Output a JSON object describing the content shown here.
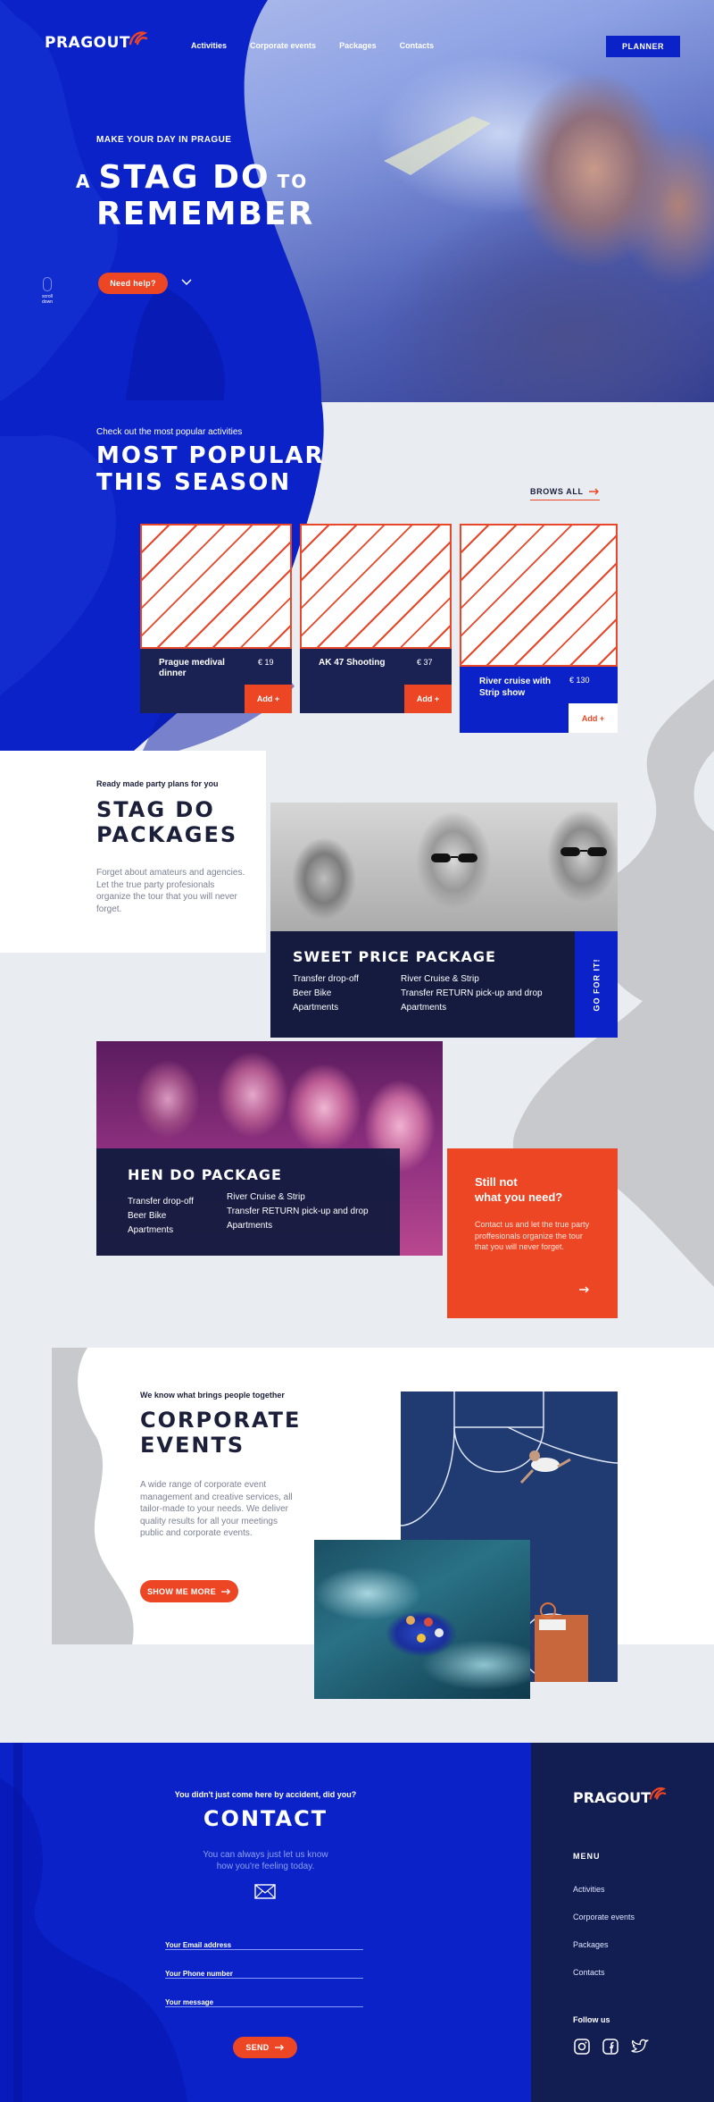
{
  "brand": {
    "logo": "PRAGOUT",
    "colors": {
      "primary_blue": "#0a22c8",
      "accent_red": "#ec4624",
      "navy": "#121d52",
      "bg": "#e9ecf1"
    }
  },
  "nav": {
    "items": [
      "Activities",
      "Corporate events",
      "Packages",
      "Contacts"
    ],
    "cta": "PLANNER"
  },
  "hero": {
    "eyebrow": "MAKE YOUR DAY IN PRAGUE",
    "title_a": "A",
    "title_stag": "STAG DO",
    "title_to": "TO",
    "title_line2": "REMEMBER",
    "help_button": "Need help?",
    "scroll_label": "scroll down"
  },
  "popular": {
    "eyebrow": "Check out the most popular activities",
    "title_line1": "MOST POPULAR",
    "title_line2": "THIS SEASON",
    "browse": "BROWS ALL",
    "cards": [
      {
        "name": "Prague medival dinner",
        "price": "€ 19",
        "add": "Add +"
      },
      {
        "name": "AK 47 Shooting",
        "price": "€ 37",
        "add": "Add +"
      },
      {
        "name": "River cruise with Strip show",
        "price": "€ 130",
        "add": "Add +"
      }
    ]
  },
  "stag": {
    "eyebrow": "Ready made party plans for you",
    "title_line1": "STAG DO",
    "title_line2": "PACKAGES",
    "description": "Forget about amateurs and agencies. Let the true party profesionals organize the tour that you will never forget.",
    "package": {
      "title": "SWEET PRICE PACKAGE",
      "col1": [
        "Transfer drop-off",
        "Beer Bike",
        "Apartments"
      ],
      "col2": [
        "River Cruise & Strip",
        "Transfer RETURN pick-up and drop",
        "Apartments"
      ],
      "cta": "GO FOR IT!"
    }
  },
  "hen": {
    "title": "HEN DO PACKAGE",
    "col1": [
      "Transfer drop-off",
      "Beer Bike",
      "Apartments"
    ],
    "col2": [
      "River Cruise & Strip",
      "Transfer RETURN pick-up and drop",
      "Apartments"
    ]
  },
  "still_not": {
    "title_line1": "Still not",
    "title_line2": "what you need?",
    "text": "Contact us and let the true party proffesionals organize the tour that you will never forget."
  },
  "corporate": {
    "eyebrow": "We know what brings people together",
    "title_line1": "CORPORATE",
    "title_line2": "EVENTS",
    "text": "A wide range of corporate event management and creative services, all tailor-made to your needs. We deliver quality results for all your meetings public and corporate events.",
    "cta": "SHOW ME MORE"
  },
  "contact": {
    "eyebrow": "You didn't just come here by accident, did you?",
    "title": "CONTACT",
    "subtitle_line1": "You can always just let us know",
    "subtitle_line2": "how you're feeling today.",
    "fields": [
      "Your Email address",
      "Your Phone number",
      "Your message"
    ],
    "send": "SEND"
  },
  "footer": {
    "logo": "PRAGOUT",
    "menu_title": "MENU",
    "menu": [
      "Activities",
      "Corporate events",
      "Packages",
      "Contacts"
    ],
    "follow": "Follow us"
  }
}
